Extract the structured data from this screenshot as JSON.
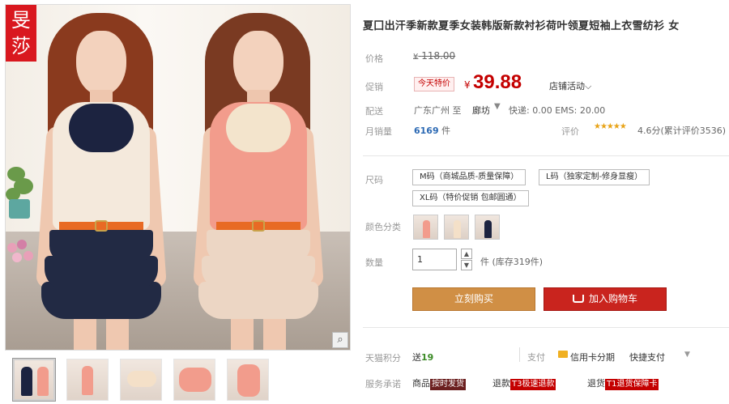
{
  "brand": {
    "logo_text": "旻莎"
  },
  "product": {
    "title": "夏囗出汗季新款夏季女装韩版新款衬衫荷叶领夏短袖上衣雪纺衫 女"
  },
  "price": {
    "label": "价格",
    "currency": "¥",
    "original": "118.00"
  },
  "promo": {
    "label": "促销",
    "tag": "今天特价",
    "currency": "¥",
    "price": "39.88",
    "store_activity": "店铺活动"
  },
  "shipping": {
    "label": "配送",
    "from": "广东广州  至",
    "to": "廊坊",
    "fee": "快递: 0.00  EMS: 20.00"
  },
  "sales": {
    "label": "月销量",
    "count": "6169",
    "unit": "件",
    "rating_label": "评价",
    "stars": "★★★★★",
    "rating_text": "4.6分(累计评价3536)"
  },
  "size": {
    "label": "尺码",
    "options": [
      "M码（商城品质-质量保障）",
      "L码（独家定制-修身显瘦）",
      "XL码（特价促销 包邮圆通）"
    ]
  },
  "color": {
    "label": "颜色分类",
    "swatch_colors": [
      "#f29c8c",
      "#f4e9dc",
      "#1c2340"
    ]
  },
  "quantity": {
    "label": "数量",
    "value": "1",
    "stock_text": "件 (库存319件)"
  },
  "actions": {
    "buy_now": "立刻购买",
    "add_cart": "加入购物车"
  },
  "points": {
    "label": "天猫积分",
    "prefix": "送",
    "value": "19"
  },
  "payment": {
    "label": "支付",
    "card": "信用卡分期",
    "quick": "快捷支付",
    "more": "▼"
  },
  "service": {
    "label": "服务承诺",
    "items": [
      {
        "prefix": "商品",
        "tag": "按时发货"
      },
      {
        "prefix": "退款",
        "tag": "T3极速退款"
      },
      {
        "prefix": "退货",
        "tag": "T1退货保障卡"
      }
    ]
  },
  "gallery": {
    "zoom_icon": "zoom-icon",
    "thumbnail_count": 5
  },
  "colors": {
    "accent_red": "#c40000",
    "buy_orange": "#d08f45",
    "cart_red": "#c9241e"
  }
}
